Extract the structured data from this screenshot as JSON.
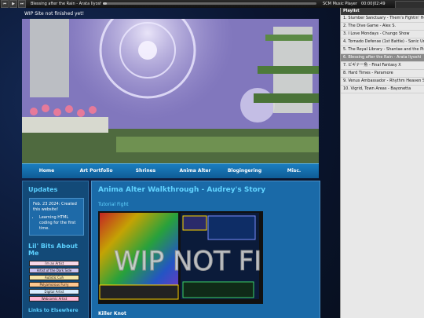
{
  "player": {
    "track": "Blessing after the Rain - Arata Iiyoshi",
    "progress": 0.02,
    "name": "SCM Music Player",
    "time": "00:00|02:49"
  },
  "playlist": {
    "title": "Playlist",
    "items": [
      "1. Slumber Sanctuary - Them's Fightin' Herds",
      "2. The Dive Game - Alex S.",
      "3. I Love Mondays - Chungo Show",
      "4. Tornado Defense (1st Battle) - Sonic Unleashed",
      "5. The Royal Library - Shantae and the Pirate's Curse",
      "6. Blessing after the Rain - Arata Iiyoshi",
      "7. ビギナー魚 - Final Fantasy X",
      "8. Hard Times - Paramore",
      "9. Venus Ambassador - Rhythm Heaven Scary",
      "10. Vigrid, Town Areas - Bayonetta"
    ],
    "active_index": 5
  },
  "site": {
    "wip_note": "WIP Site not finished yet!",
    "nav": [
      "Home",
      "Art Portfolio",
      "Shrines",
      "Anima Alter",
      "Blogingering",
      "Misc."
    ]
  },
  "sidebar": {
    "updates_title": "Updates",
    "update_text": "Feb. 23 2024: Created this website!",
    "update_bullet": "Learning HTML coding for the first time.",
    "bits_title": "Lil' Bits About Me",
    "stamps": [
      "i'm an Artist",
      "Artist of the Dark Side",
      "Autistic Cuh",
      "Polyamorous Furry",
      "Digital Artist",
      "Webcomic Artist"
    ],
    "links_title": "Links to Elsewhere"
  },
  "content": {
    "title": "Anima Alter Walkthrough - Audrey's Story",
    "subtitle": "Tutorial Fight",
    "overlay_text": "WIP NOT FIN",
    "caption": "Killer Knot"
  },
  "colors": {
    "accent": "#62d4ff",
    "nav": "#1b7ec0",
    "panel": "#1a6aa8"
  }
}
